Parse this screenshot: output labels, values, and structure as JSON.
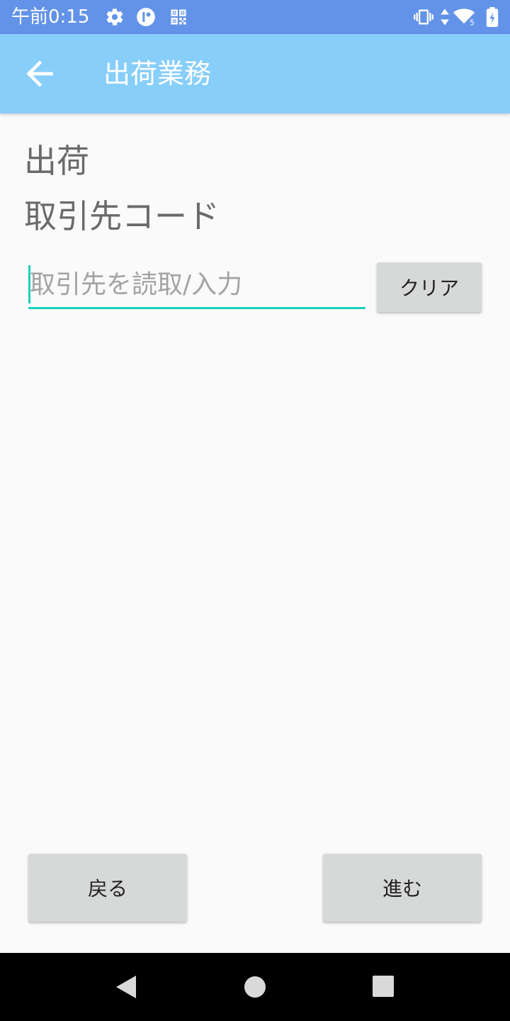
{
  "status_bar": {
    "time": "午前0:15",
    "icons": [
      "gear-icon",
      "app-indicator-icon",
      "qr-code-icon",
      "vibrate-icon",
      "data-arrows-icon",
      "wifi-icon",
      "battery-charging-icon"
    ],
    "wifi_badge": "5"
  },
  "app_bar": {
    "title": "出荷業務",
    "back_icon": "arrow-left-icon"
  },
  "form": {
    "section_label": "出荷",
    "field_label": "取引先コード",
    "input_value": "",
    "input_placeholder": "取引先を読取/入力",
    "clear_label": "クリア"
  },
  "footer": {
    "back_label": "戻る",
    "next_label": "進む"
  },
  "nav_bar": {
    "icons": [
      "nav-back-icon",
      "nav-home-icon",
      "nav-recents-icon"
    ]
  },
  "colors": {
    "status_bar": "#6393e8",
    "app_bar": "#87cefa",
    "accent": "#1ccfbf",
    "button": "#d7d8d8",
    "background": "#fafafa"
  }
}
